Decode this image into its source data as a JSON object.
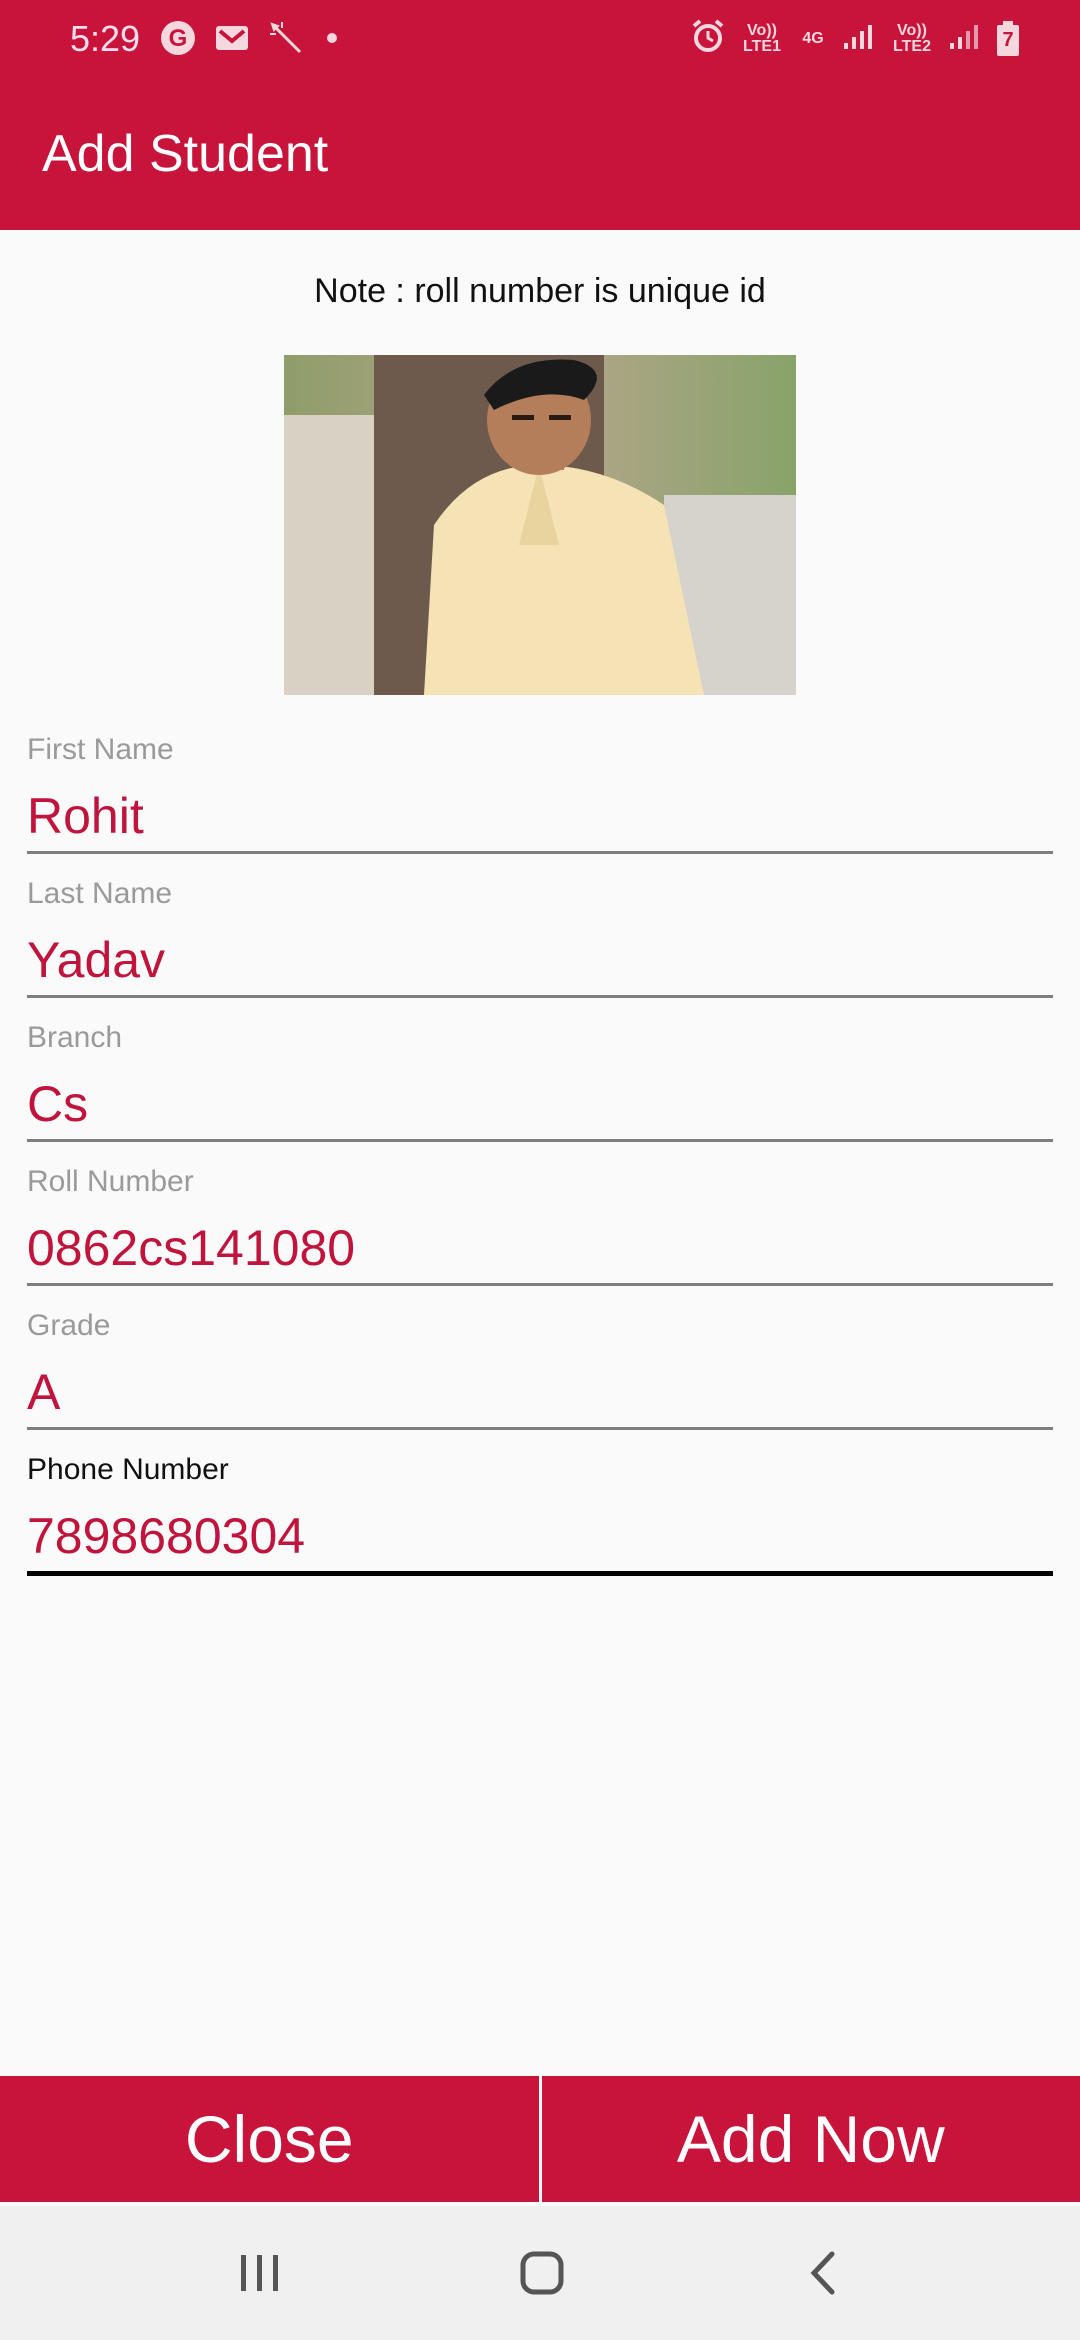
{
  "status": {
    "time": "5:29",
    "left_icons": [
      "google-icon",
      "gmail-icon",
      "magic-wand-icon",
      "dot-icon"
    ],
    "right_icons": [
      "alarm-icon",
      "volte-lte1-icon",
      "4g-icon",
      "signal-icon",
      "volte-lte2-icon",
      "signal-icon",
      "battery-icon"
    ],
    "lte1": "Vo)) LTE1",
    "net": "4G",
    "lte2": "Vo)) LTE2",
    "battery_level": "7"
  },
  "appbar": {
    "title": "Add Student"
  },
  "note": "Note : roll number is unique id",
  "form": {
    "first_name": {
      "label": "First Name",
      "value": "Rohit"
    },
    "last_name": {
      "label": "Last Name",
      "value": "Yadav"
    },
    "branch": {
      "label": "Branch",
      "value": "Cs"
    },
    "roll_number": {
      "label": "Roll Number",
      "value": "0862cs141080"
    },
    "grade": {
      "label": "Grade",
      "value": "A"
    },
    "phone_number": {
      "label": "Phone Number",
      "value": "7898680304"
    }
  },
  "actions": {
    "close": "Close",
    "add_now": "Add Now"
  },
  "colors": {
    "primary": "#c8133a",
    "value_text": "#c0143c"
  }
}
